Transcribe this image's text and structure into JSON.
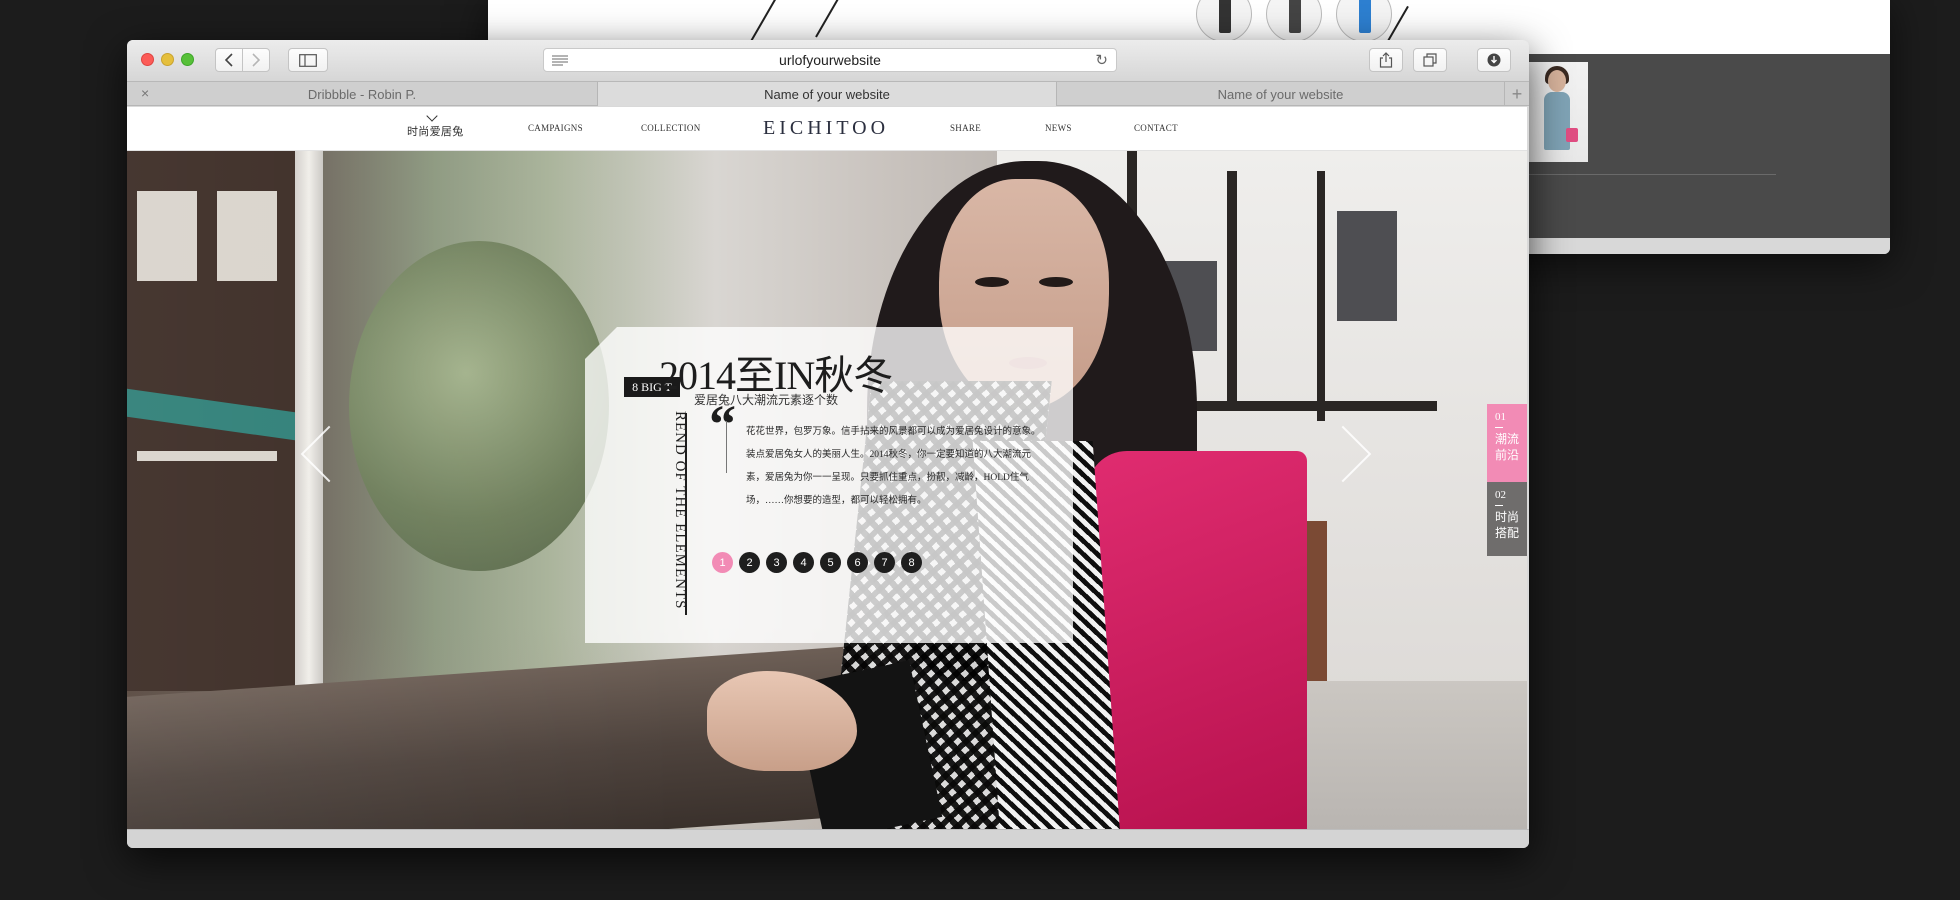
{
  "browser": {
    "url": "urlofyourwebsite",
    "tabs": [
      {
        "label": "Dribbble  -  Robin P.",
        "active": false
      },
      {
        "label": "Name of your website",
        "active": true
      },
      {
        "label": "Name of your website",
        "active": false
      }
    ],
    "icons": {
      "back": "chevron-left-icon",
      "forward": "chevron-right-icon",
      "sidebar": "sidebar-icon",
      "share": "share-icon",
      "tabs": "tabs-overview-icon",
      "download": "download-icon",
      "reload": "reload-icon"
    }
  },
  "site": {
    "logo": "EICHITOO",
    "nav": {
      "home": "时尚爱居兔",
      "campaigns": "CAMPAIGNS",
      "collection": "COLLECTION",
      "share": "SHARE",
      "news": "NEWS",
      "contact": "CONTACT"
    },
    "hero": {
      "title": "2014至IN秋冬",
      "subtitle": "爱居兔八大潮流元素逐个数",
      "badge": "8 BIG T",
      "vertical_text": "REND OF THE ELEMENTS",
      "quote_mark": "“",
      "paragraph": "花花世界，包罗万象。信手拈来的风景都可以成为爱居兔设计的意象。装点爱居兔女人的美丽人生。2014秋冬，你一定要知道的八大潮流元素，爱居兔为你一一呈现。只要抓住重点，扮靓，减龄，HOLD住气场，……你想要的造型，都可以轻松拥有。",
      "pager": [
        "1",
        "2",
        "3",
        "4",
        "5",
        "6",
        "7",
        "8"
      ],
      "pager_active": 0
    },
    "side_tabs": [
      {
        "num": "01",
        "label": "潮流前沿",
        "color": "#f28bb5"
      },
      {
        "num": "02",
        "label": "时尚搭配",
        "color": "#5a5858"
      }
    ]
  },
  "colors": {
    "accent_pink": "#f28bb5",
    "logo": "#2b2f3f"
  }
}
